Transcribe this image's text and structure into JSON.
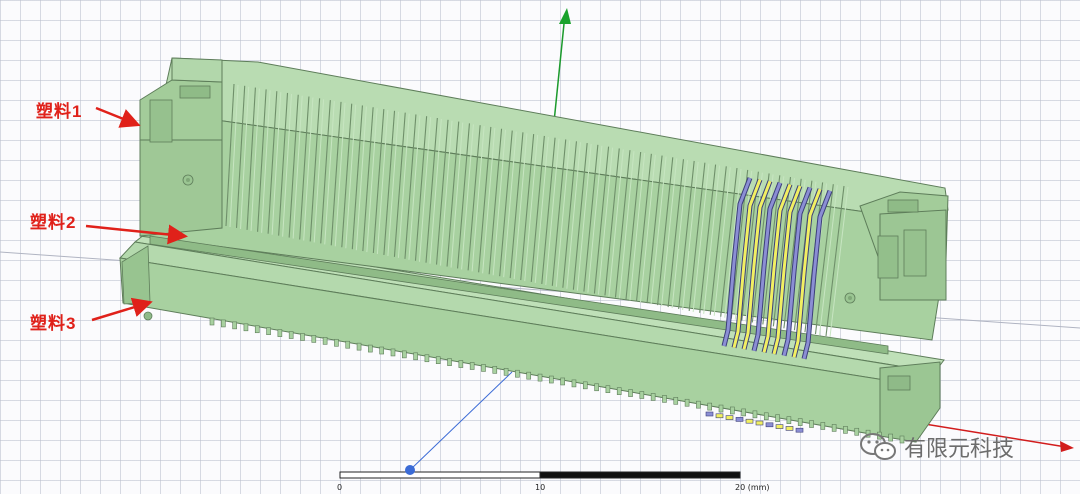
{
  "annotations": [
    {
      "id": "plastic-1",
      "text": "塑料1"
    },
    {
      "id": "plastic-2",
      "text": "塑料2"
    },
    {
      "id": "plastic-3",
      "text": "塑料3"
    }
  ],
  "watermark": {
    "text": "有限元科技",
    "icon": "wechat-icon"
  },
  "scale_bar": {
    "label_0": "0",
    "label_10": "10",
    "label_20": "20 (mm)"
  },
  "colors": {
    "body": "#a8d1a0",
    "edge": "#5e7d5a",
    "pin_yellow": "#f1ef62",
    "pin_blue": "#8b8ed4",
    "arrow": "#e0211a",
    "axis_y": "#17a02a",
    "axis_x": "#d21c1c"
  },
  "axes": {
    "y_axis_label": "",
    "x_axis_label": ""
  }
}
